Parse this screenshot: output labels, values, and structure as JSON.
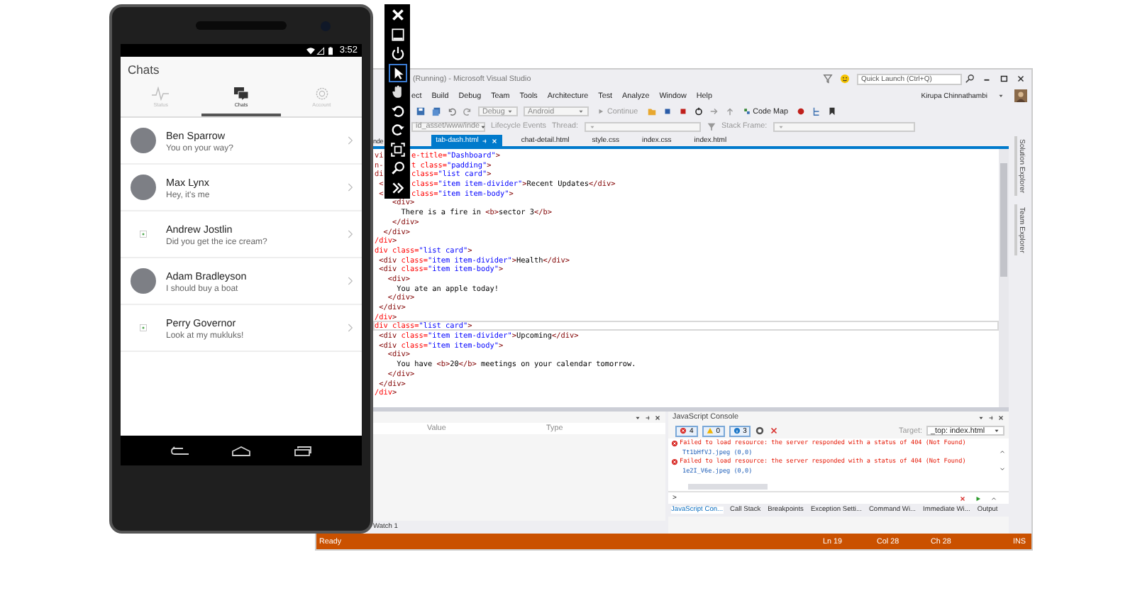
{
  "emulator": {
    "status_time": "3:52",
    "app_title": "Chats",
    "tabs": [
      {
        "label": "Status",
        "selected": false
      },
      {
        "label": "Chats",
        "selected": true
      },
      {
        "label": "Account",
        "selected": false
      }
    ],
    "chats": [
      {
        "name": "Ben Sparrow",
        "message": "You on your way?",
        "kind": "photo"
      },
      {
        "name": "Max Lynx",
        "message": "Hey, it's me",
        "kind": "photo"
      },
      {
        "name": "Andrew Jostlin",
        "message": "Did you get the ice cream?",
        "kind": "missing"
      },
      {
        "name": "Adam Bradleyson",
        "message": "I should buy a boat",
        "kind": "photo"
      },
      {
        "name": "Perry Governor",
        "message": "Look at my mukluks!",
        "kind": "missing"
      }
    ]
  },
  "ide": {
    "title": "(Running) - Microsoft Visual Studio",
    "quick_launch_placeholder": "Quick Launch (Ctrl+Q)",
    "menu": [
      "ect",
      "Build",
      "Debug",
      "Team",
      "Tools",
      "Architecture",
      "Test",
      "Analyze",
      "Window",
      "Help"
    ],
    "user": "Kirupa Chinnathambi",
    "toolbar": {
      "configuration": "Debug",
      "platform": "Android",
      "continue": "Continue",
      "code_map": "Code Map"
    },
    "debug_bar": {
      "location": "id_asset/www/inde",
      "lifecycle": "Lifecycle Events",
      "thread_label": "Thread:",
      "stack_frame_label": "Stack Frame:"
    },
    "tabs": [
      {
        "label": "nde",
        "selected": false
      },
      {
        "label": "tab-dash.html",
        "selected": true
      },
      {
        "label": "chat-detail.html",
        "selected": false
      },
      {
        "label": "style.css",
        "selected": false
      },
      {
        "label": "index.css",
        "selected": false
      },
      {
        "label": "index.html",
        "selected": false
      }
    ],
    "code_lines": [
      {
        "pre": "vi",
        "text": "e-title=\"Dashboard\">",
        "current": false
      },
      {
        "pre": "n-",
        "text": "t class=\"padding\">",
        "current": false
      },
      {
        "pre": "di",
        "text": "class=\"list card\">",
        "current": false
      },
      {
        "pre": " <",
        "text": "class=\"item item-divider\">Recent Updates</div>",
        "current": false
      },
      {
        "pre": " <",
        "text": "class=\"item item-body\">",
        "current": false
      },
      {
        "text": "    <div>",
        "current": false
      },
      {
        "text": "      There is a fire in <b>sector 3</b>",
        "current": false
      },
      {
        "text": "    </div>",
        "current": false
      },
      {
        "text": "  </div>",
        "current": false
      },
      {
        "text": "/div>",
        "current": false
      },
      {
        "text": "div class=\"list card\">",
        "current": false
      },
      {
        "text": " <div class=\"item item-divider\">Health</div>",
        "current": false
      },
      {
        "text": " <div class=\"item item-body\">",
        "current": false
      },
      {
        "text": "   <div>",
        "current": false
      },
      {
        "text": "     You ate an apple today!",
        "current": false
      },
      {
        "text": "   </div>",
        "current": false
      },
      {
        "text": " </div>",
        "current": false
      },
      {
        "text": "/div>",
        "current": false
      },
      {
        "text": "div class=\"list card\">",
        "current": true
      },
      {
        "text": " <div class=\"item item-divider\">Upcoming</div>",
        "current": false
      },
      {
        "text": " <div class=\"item item-body\">",
        "current": false
      },
      {
        "text": "   <div>",
        "current": false
      },
      {
        "text": "     You have <b>20</b> meetings on your calendar tomorrow.",
        "current": false
      },
      {
        "text": "   </div>",
        "current": false
      },
      {
        "text": " </div>",
        "current": false
      },
      {
        "text": "/div>",
        "current": false
      }
    ],
    "side_tabs": [
      "Solution Explorer",
      "Team Explorer"
    ],
    "watch": {
      "columns": [
        "Value",
        "Type"
      ],
      "tab": "Watch 1"
    },
    "console": {
      "title": "JavaScript Console",
      "errors": "4",
      "warnings": "0",
      "messages": "3",
      "target_label": "Target:",
      "target": "_top: index.html",
      "entries": [
        {
          "text": "Failed to load resource: the server responded with a status of 404 (Not Found)",
          "link": "Tt1bHfVJ.jpeg (0,0)"
        },
        {
          "text": "Failed to load resource: the server responded with a status of 404 (Not Found)",
          "link": "1e2I_V6e.jpeg (0,0)"
        }
      ],
      "prompt": ">"
    },
    "bottom_tabs": [
      {
        "label": "JavaScript Con...",
        "selected": true
      },
      {
        "label": "Call Stack",
        "selected": false
      },
      {
        "label": "Breakpoints",
        "selected": false
      },
      {
        "label": "Exception Setti...",
        "selected": false
      },
      {
        "label": "Command Wi...",
        "selected": false
      },
      {
        "label": "Immediate Wi...",
        "selected": false
      },
      {
        "label": "Output",
        "selected": false
      }
    ],
    "status_bar": {
      "state": "Ready",
      "line": "Ln 19",
      "col": "Col 28",
      "ch": "Ch 28",
      "mode": "INS"
    }
  }
}
